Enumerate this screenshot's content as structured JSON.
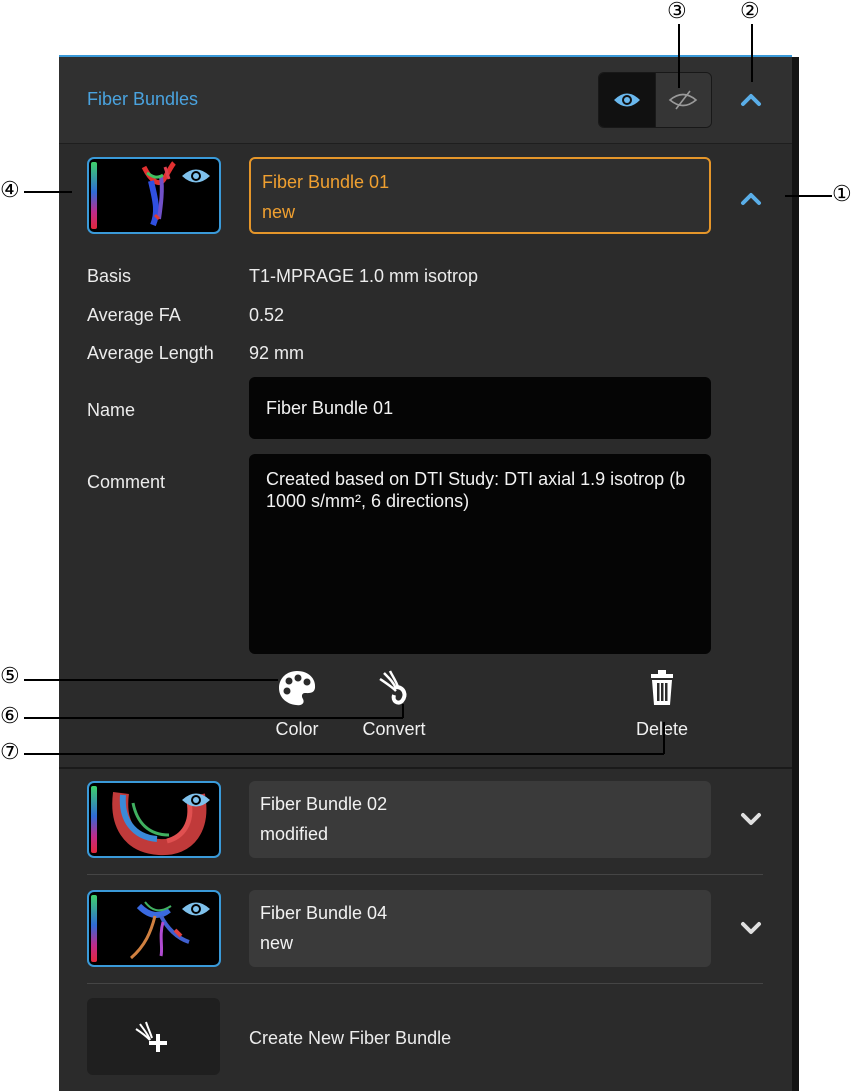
{
  "panel": {
    "title": "Fiber Bundles",
    "accent_color": "#3a9ad9",
    "active_color": "#e5962a",
    "visibility_show_icon": "eye-icon",
    "visibility_hide_icon": "eye-slash-icon",
    "collapse_icon": "chevron-up-icon"
  },
  "active_bundle": {
    "name": "Fiber Bundle 01",
    "status": "new",
    "details": [
      {
        "label": "Basis",
        "value": "T1-MPRAGE 1.0 mm isotrop"
      },
      {
        "label": "Average FA",
        "value": "0.52"
      },
      {
        "label": "Average Length",
        "value": "92 mm"
      }
    ],
    "name_label": "Name",
    "name_value": "Fiber Bundle 01",
    "comment_label": "Comment",
    "comment_value": "Created based on DTI Study: DTI axial 1.9 isotrop (b 1000 s/mm², 6 directions)",
    "actions": [
      {
        "label": "Color",
        "icon": "palette-icon"
      },
      {
        "label": "Convert",
        "icon": "convert-fiber-icon"
      },
      {
        "label": "Delete",
        "icon": "trash-icon"
      }
    ]
  },
  "bundles": [
    {
      "name": "Fiber Bundle 02",
      "status": "modified",
      "icon": "chevron-down-icon"
    },
    {
      "name": "Fiber Bundle 04",
      "status": "new",
      "icon": "chevron-down-icon"
    }
  ],
  "create": {
    "label": "Create New Fiber Bundle",
    "icon": "add-fiber-icon"
  },
  "callouts": [
    "①",
    "②",
    "③",
    "④",
    "⑤",
    "⑥",
    "⑦"
  ]
}
